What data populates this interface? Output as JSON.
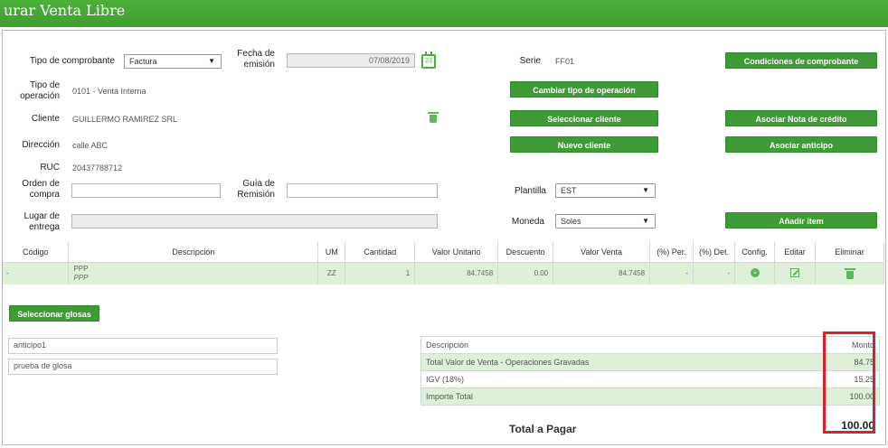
{
  "window": {
    "title": "urar Venta Libre"
  },
  "form": {
    "tipo_comprobante_label": "Tipo de comprobante",
    "tipo_comprobante_value": "Factura",
    "fecha_label_1": "Fecha de",
    "fecha_label_2": "emisión",
    "fecha_value": "07/08/2019",
    "calendar_day": "23",
    "serie_label": "Serie",
    "serie_value": "FF01",
    "tipo_operacion_label_1": "Tipo de",
    "tipo_operacion_label_2": "operación",
    "tipo_operacion_value": "0101 - Venta Interna",
    "cliente_label": "Cliente",
    "cliente_value": "GUILLERMO RAMIREZ SRL",
    "direccion_label": "Dirección",
    "direccion_value": "calle ABC",
    "ruc_label": "RUC",
    "ruc_value": "20437788712",
    "orden_label_1": "Orden de",
    "orden_label_2": "compra",
    "orden_value": "",
    "guia_label_1": "Guía de",
    "guia_label_2": "Remisión",
    "guia_value": "",
    "lugar_label_1": "Lugar de",
    "lugar_label_2": "entrega",
    "lugar_value": "",
    "plantilla_label": "Plantilla",
    "plantilla_value": "EST",
    "moneda_label": "Moneda",
    "moneda_value": "Soles"
  },
  "buttons": {
    "condiciones": "Condiciones de comprobante",
    "cambiar_operacion": "Cambiar tipo de operación",
    "seleccionar_cliente": "Seleccionar cliente",
    "asociar_nota": "Asociar Nota de crédito",
    "nuevo_cliente": "Nuevo cliente",
    "asociar_anticipo": "Asociar anticipo",
    "anadir_item": "Añadir ítem",
    "seleccionar_glosas": "Seleccionar glosas"
  },
  "items_table": {
    "headers": [
      "Código",
      "Descripción",
      "UM",
      "Cantidad",
      "Valor Unitario",
      "Descuento",
      "Valor Venta",
      "(%) Per.",
      "(%) Det.",
      "Config.",
      "Editar",
      "Eliminar"
    ],
    "rows": [
      {
        "codigo": "-",
        "descripcion_1": "PPP",
        "descripcion_2": "PPP",
        "um": "ZZ",
        "cantidad": "1",
        "valor_unitario": "84.7458",
        "descuento": "0.00",
        "valor_venta": "84.7458",
        "per": "-",
        "det": "-"
      }
    ]
  },
  "glosas": [
    "anticipo1",
    "prueba de glosa"
  ],
  "summary": {
    "header_desc": "Descripción",
    "header_monto": "Monto",
    "rows": [
      {
        "desc": "Total Valor de Venta - Operaciones Gravadas",
        "monto": "84.75"
      },
      {
        "desc": "IGV (18%)",
        "monto": "15.25"
      },
      {
        "desc": "Importe Total",
        "monto": "100.00"
      }
    ],
    "total_label": "Total a Pagar",
    "total_value": "100.00"
  },
  "colors": {
    "brand_green": "#3e9b35",
    "row_green": "#dff0d8",
    "highlight": "#d9202f"
  }
}
